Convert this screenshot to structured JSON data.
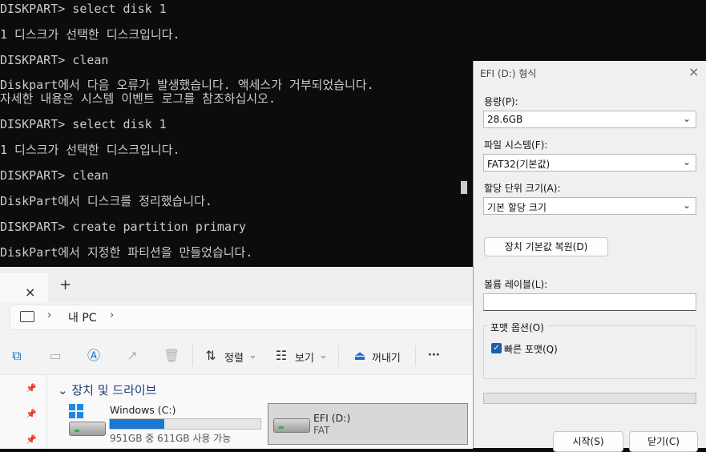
{
  "terminal": {
    "lines": [
      "DISKPART> select disk 1",
      "1 디스크가 선택한 디스크입니다.",
      "DISKPART> clean",
      "Diskpart에서 다음 오류가 발생했습니다. 액세스가 거부되었습니다.",
      "자세한 내용은 시스템 이벤트 로그를 참조하십시오.",
      "DISKPART> select disk 1",
      "1 디스크가 선택한 디스크입니다.",
      "DISKPART> clean",
      "DiskPart에서 디스크를 정리했습니다.",
      "DISKPART> create partition primary",
      "DiskPart에서 지정한 파티션을 만들었습니다."
    ]
  },
  "explorer": {
    "tab_close_icon": "×",
    "tab_add_icon": "+",
    "breadcrumb": "내 PC",
    "chevron": "›",
    "toolbar": {
      "sort_label": "정렬",
      "view_label": "보기",
      "eject_label": "꺼내기",
      "more_label": "···"
    },
    "section_title": "장치 및 드라이브",
    "drives": [
      {
        "name": "Windows (C:)",
        "detail": "951GB 중 611GB 사용 가능",
        "used_fraction": 0.36
      },
      {
        "name": "EFI (D:)",
        "detail": "FAT"
      }
    ]
  },
  "dialog": {
    "title": "EFI (D:) 형식",
    "close_icon": "×",
    "capacity_label": "용량(P):",
    "capacity_value": "28.6GB",
    "filesystem_label": "파일 시스템(F):",
    "filesystem_value": "FAT32(기본값)",
    "alloc_label": "할당 단위 크기(A):",
    "alloc_value": "기본 할당 크기",
    "restore_defaults": "장치 기본값 복원(D)",
    "volume_label": "볼륨 레이블(L):",
    "volume_value": "",
    "format_options": "포맷 옵션(O)",
    "quick_format": "빠른 포맷(Q)",
    "quick_format_checked": true,
    "progress": 0,
    "start_button": "시작(S)",
    "close_button": "닫기(C)"
  }
}
